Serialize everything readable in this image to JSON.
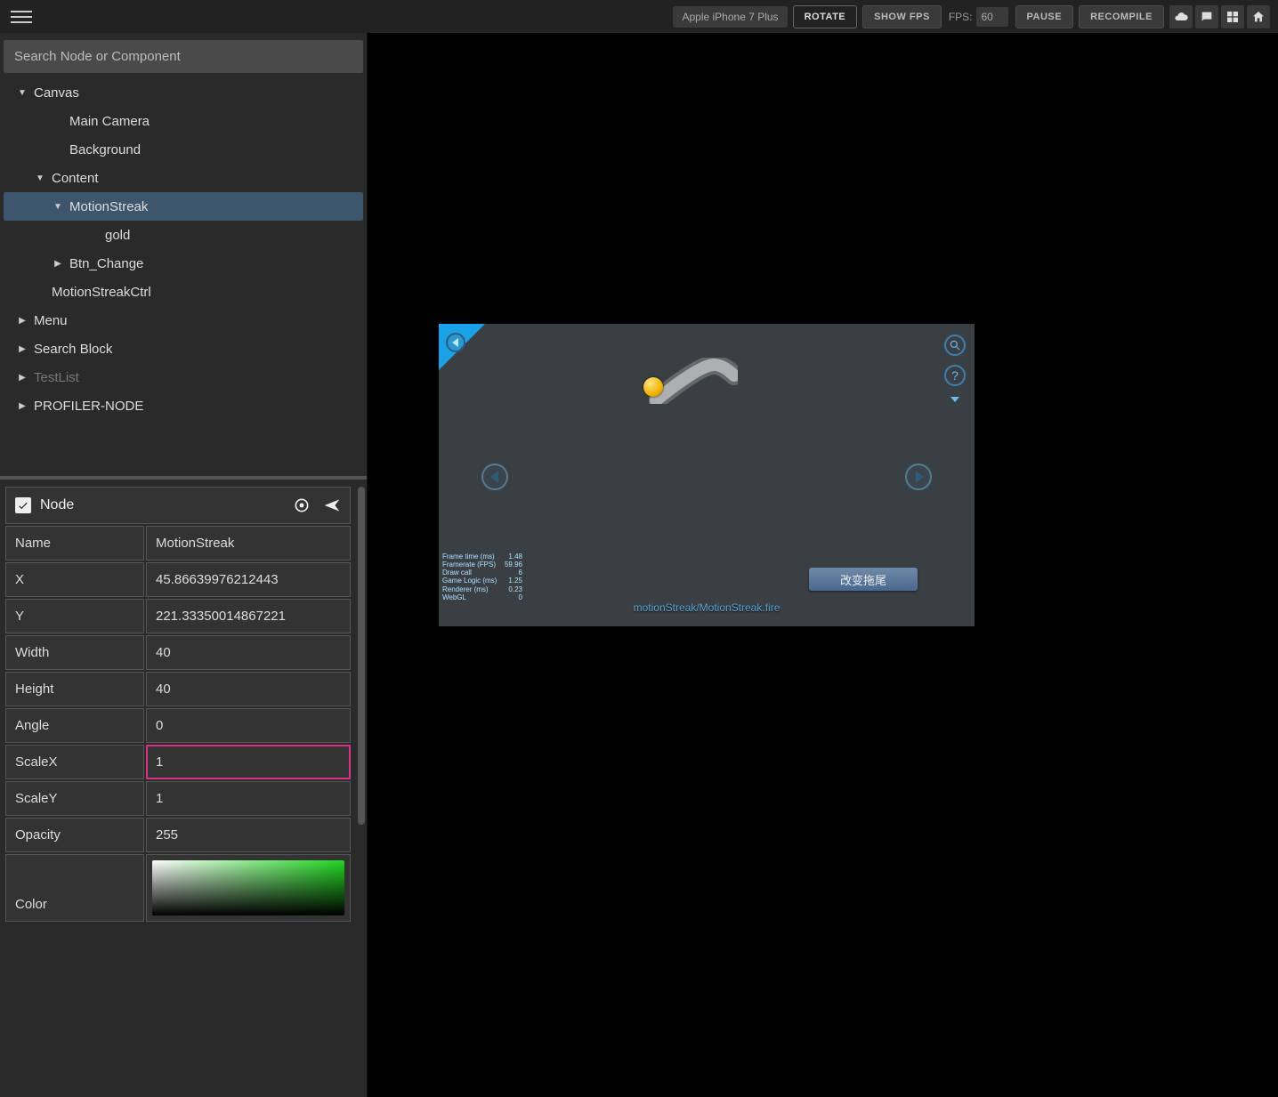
{
  "topbar": {
    "device": "Apple iPhone 7 Plus",
    "rotate": "ROTATE",
    "show_fps": "SHOW FPS",
    "fps_label": "FPS:",
    "fps_value": "60",
    "pause": "PAUSE",
    "recompile": "RECOMPILE"
  },
  "hierarchy": {
    "search_placeholder": "Search Node or Component",
    "items": [
      {
        "label": "Canvas",
        "indent": "ind-0",
        "caret": "down"
      },
      {
        "label": "Main Camera",
        "indent": "ind-1nc"
      },
      {
        "label": "Background",
        "indent": "ind-1nc"
      },
      {
        "label": "Content",
        "indent": "ind-1",
        "caret": "down"
      },
      {
        "label": "MotionStreak",
        "indent": "ind-2",
        "caret": "down",
        "selected": true
      },
      {
        "label": "gold",
        "indent": "ind-3nc"
      },
      {
        "label": "Btn_Change",
        "indent": "ind-2",
        "caret": "right"
      },
      {
        "label": "MotionStreakCtrl",
        "indent": "ind-1"
      },
      {
        "label": "Menu",
        "indent": "ind-0",
        "caret": "right"
      },
      {
        "label": "Search Block",
        "indent": "ind-0",
        "caret": "right"
      },
      {
        "label": "TestList",
        "indent": "ind-0",
        "caret": "right",
        "dim": true
      },
      {
        "label": "PROFILER-NODE",
        "indent": "ind-0",
        "caret": "right"
      }
    ]
  },
  "inspector": {
    "header": "Node",
    "props": {
      "name": {
        "label": "Name",
        "value": "MotionStreak"
      },
      "x": {
        "label": "X",
        "value": "45.86639976212443"
      },
      "y": {
        "label": "Y",
        "value": "221.33350014867221"
      },
      "width": {
        "label": "Width",
        "value": "40"
      },
      "height": {
        "label": "Height",
        "value": "40"
      },
      "angle": {
        "label": "Angle",
        "value": "0"
      },
      "scalex": {
        "label": "ScaleX",
        "value": "1"
      },
      "scaley": {
        "label": "ScaleY",
        "value": "1"
      },
      "opacity": {
        "label": "Opacity",
        "value": "255"
      },
      "color": {
        "label": "Color"
      }
    }
  },
  "game": {
    "button": "改变拖尾",
    "scene_path": "motionStreak/MotionStreak.fire",
    "stats": [
      {
        "k": "Frame time (ms)",
        "v": "1.48"
      },
      {
        "k": "Framerate (FPS)",
        "v": "59.96"
      },
      {
        "k": "Draw call",
        "v": "6"
      },
      {
        "k": "Game Logic (ms)",
        "v": "1.25"
      },
      {
        "k": "Renderer (ms)",
        "v": "0.23"
      },
      {
        "k": "WebGL",
        "v": "0"
      }
    ]
  }
}
